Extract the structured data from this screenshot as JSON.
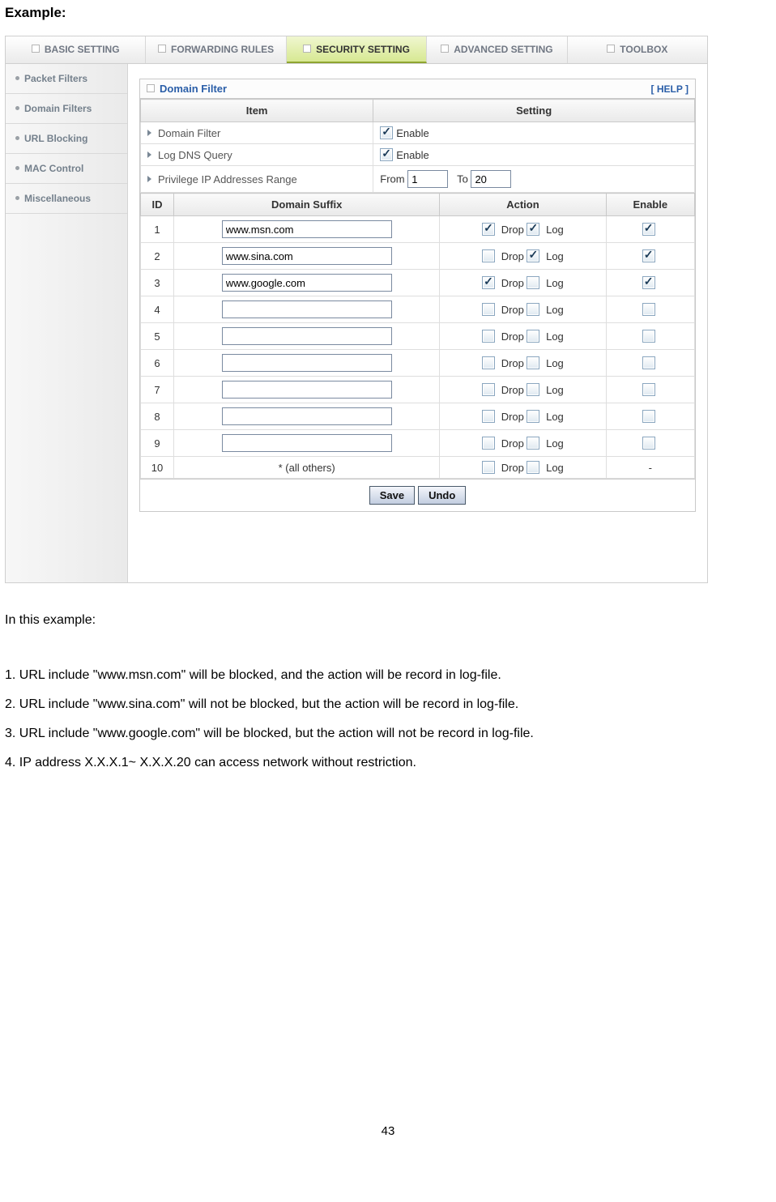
{
  "doc": {
    "heading": "Example:",
    "intro": "In this example:",
    "bullets": [
      "1. URL include \"www.msn.com\" will be blocked, and the action will be record in log-file.",
      "2. URL include \"www.sina.com\" will not be blocked, but the action will be record in log-file.",
      "3. URL include \"www.google.com\" will be blocked, but the action will not be record in log-file.",
      "4. IP address X.X.X.1~ X.X.X.20 can access network without restriction."
    ],
    "page_number": "43"
  },
  "topnav": {
    "items": [
      {
        "label": "BASIC SETTING"
      },
      {
        "label": "FORWARDING RULES"
      },
      {
        "label": "SECURITY SETTING"
      },
      {
        "label": "ADVANCED SETTING"
      },
      {
        "label": "TOOLBOX"
      }
    ]
  },
  "sidebar": {
    "items": [
      {
        "label": "Packet Filters"
      },
      {
        "label": "Domain Filters"
      },
      {
        "label": "URL Blocking"
      },
      {
        "label": "MAC Control"
      },
      {
        "label": "Miscellaneous"
      }
    ]
  },
  "panel": {
    "title": "Domain Filter",
    "help": "[ HELP ]",
    "headers1": {
      "item": "Item",
      "setting": "Setting"
    },
    "rows1": {
      "domain_filter": {
        "label": "Domain Filter",
        "setting_label": "Enable",
        "checked": true
      },
      "log_dns": {
        "label": "Log DNS Query",
        "setting_label": "Enable",
        "checked": true
      },
      "priv_range": {
        "label": "Privilege IP Addresses Range",
        "from_label": "From",
        "from_val": "1",
        "to_label": "To",
        "to_val": "20"
      }
    },
    "headers2": {
      "id": "ID",
      "suffix": "Domain Suffix",
      "action": "Action",
      "enable": "Enable"
    },
    "action_labels": {
      "drop": "Drop",
      "log": "Log"
    },
    "rows2": [
      {
        "id": "1",
        "suffix": "www.msn.com",
        "drop": true,
        "log": true,
        "enable": true,
        "is_input": true
      },
      {
        "id": "2",
        "suffix": "www.sina.com",
        "drop": false,
        "log": true,
        "enable": true,
        "is_input": true
      },
      {
        "id": "3",
        "suffix": "www.google.com",
        "drop": true,
        "log": false,
        "enable": true,
        "is_input": true
      },
      {
        "id": "4",
        "suffix": "",
        "drop": false,
        "log": false,
        "enable": false,
        "is_input": true
      },
      {
        "id": "5",
        "suffix": "",
        "drop": false,
        "log": false,
        "enable": false,
        "is_input": true
      },
      {
        "id": "6",
        "suffix": "",
        "drop": false,
        "log": false,
        "enable": false,
        "is_input": true
      },
      {
        "id": "7",
        "suffix": "",
        "drop": false,
        "log": false,
        "enable": false,
        "is_input": true
      },
      {
        "id": "8",
        "suffix": "",
        "drop": false,
        "log": false,
        "enable": false,
        "is_input": true
      },
      {
        "id": "9",
        "suffix": "",
        "drop": false,
        "log": false,
        "enable": false,
        "is_input": true
      },
      {
        "id": "10",
        "suffix": "* (all others)",
        "drop": false,
        "log": false,
        "enable_text": "-",
        "is_input": false
      }
    ],
    "buttons": {
      "save": "Save",
      "undo": "Undo"
    }
  }
}
